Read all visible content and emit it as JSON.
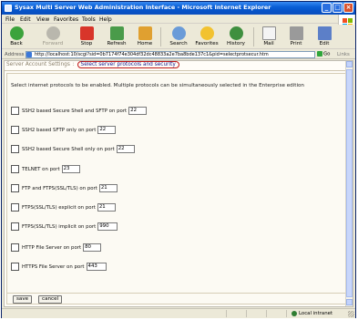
{
  "window": {
    "title": "Sysax Multi Server Web Administration Interface - Microsoft Internet Explorer"
  },
  "menu": [
    "File",
    "Edit",
    "View",
    "Favorites",
    "Tools",
    "Help"
  ],
  "toolbar": {
    "back": "Back",
    "forward": "Forward",
    "stop": "Stop",
    "refresh": "Refresh",
    "home": "Home",
    "search": "Search",
    "favorites": "Favorites",
    "history": "History",
    "mail": "Mail",
    "print": "Print",
    "edit": "Edit"
  },
  "address": {
    "label": "Address",
    "url": "http://localhost:10/scgi?sid=0b7174f74e304df32dc48833a2e7ba8bde137c1&pid=selectprotsecur.htm",
    "go": "Go",
    "links": "Links"
  },
  "breadcrumb": {
    "parent": "Server Account Settings",
    "separator": ":",
    "current": "Select server protocols and security"
  },
  "intro": "Select internet protocols to be enabled. Multiple protocols can be simultaneously selected in the Enterprise edition",
  "protocols": [
    {
      "label": "SSH2 based Secure Shell and SFTP on port",
      "port": "22",
      "checked": false
    },
    {
      "label": "SSH2 based SFTP only on port",
      "port": "22",
      "checked": false
    },
    {
      "label": "SSH2 based Secure Shell only on port",
      "port": "22",
      "checked": false
    },
    {
      "label": "TELNET on port",
      "port": "23",
      "checked": false
    },
    {
      "label": "FTP and FTPS(SSL/TLS) on port",
      "port": "21",
      "checked": false
    },
    {
      "label": "FTPS(SSL/TLS) explicit on port",
      "port": "21",
      "checked": false
    },
    {
      "label": "FTPS(SSL/TLS) implicit on port",
      "port": "990",
      "checked": false
    },
    {
      "label": "HTTP File Server on port",
      "port": "80",
      "checked": false
    },
    {
      "label": "HTTPS File Server on port",
      "port": "443",
      "checked": false
    }
  ],
  "buttons": {
    "save": "save",
    "cancel": "cancel"
  },
  "status": {
    "zone": "Local intranet"
  },
  "colors": {
    "titlebar": "#0a5fd6",
    "highlight_border": "#c01818",
    "page_bg": "#fcfaf3"
  }
}
